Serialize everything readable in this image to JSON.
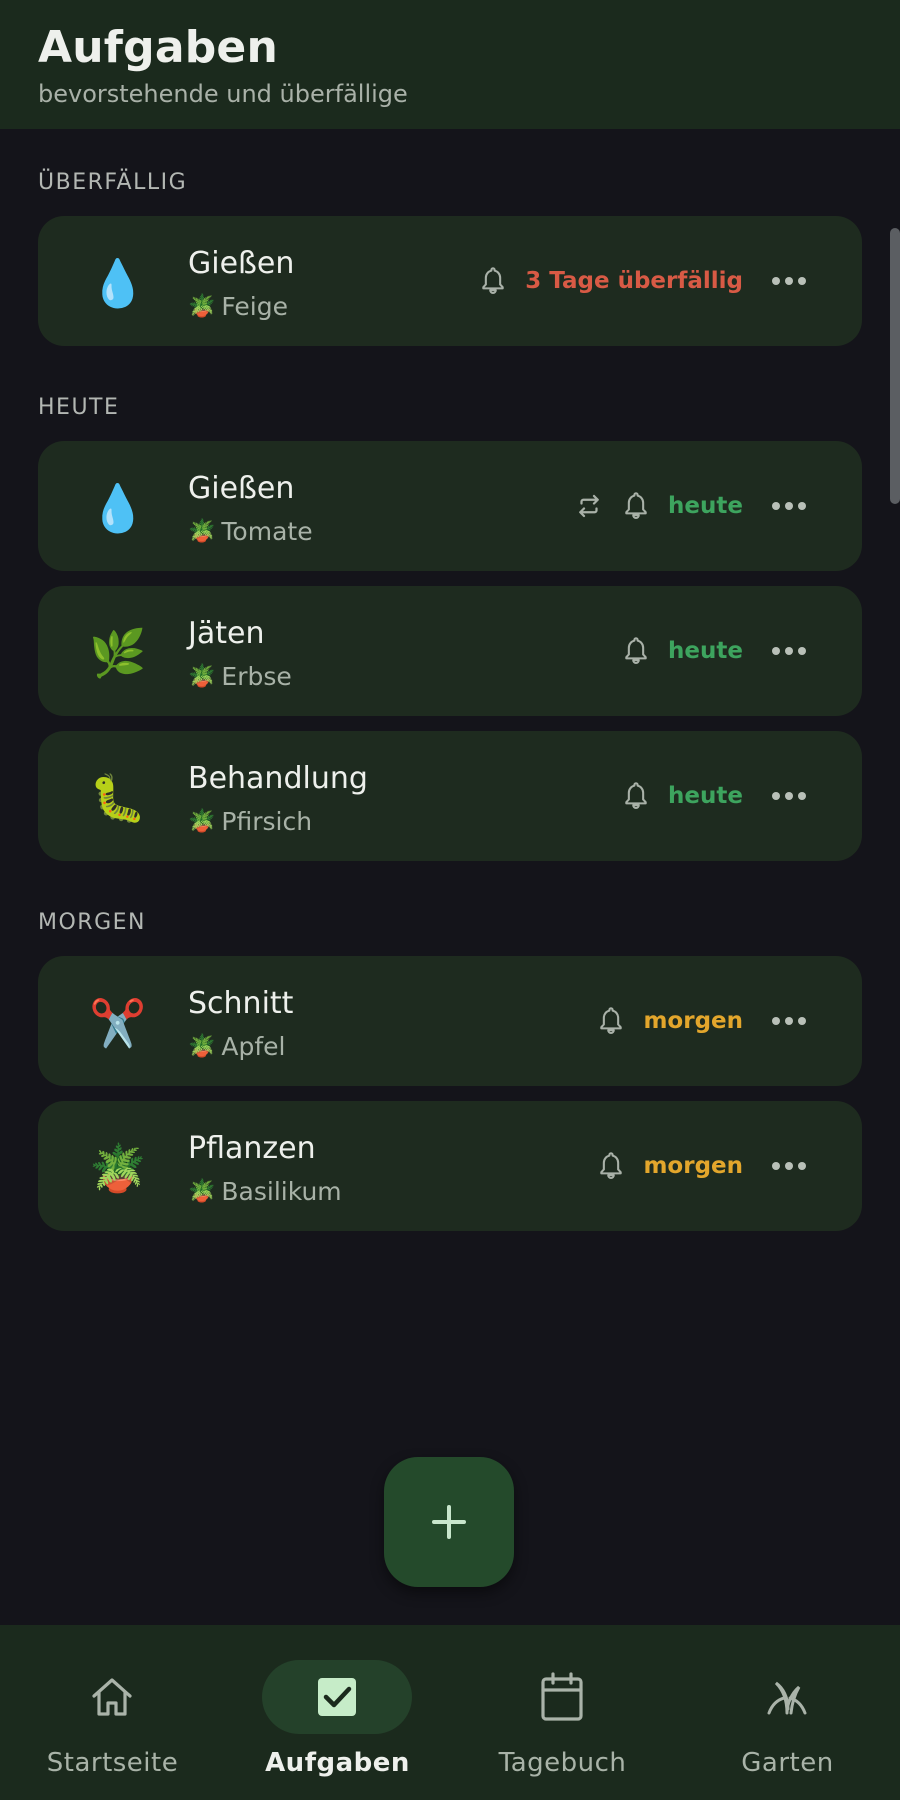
{
  "header": {
    "title": "Aufgaben",
    "subtitle": "bevorstehende und überfällige"
  },
  "sections": {
    "overdue": "ÜBERFÄLLIG",
    "today": "HEUTE",
    "tomorrow": "MORGEN"
  },
  "tasks": [
    {
      "icon": "droplet-icon",
      "emoji": "💧",
      "name": "Gießen",
      "plant": "Feige",
      "status": "3 Tage überfällig",
      "status_color": "#d85a45",
      "repeat": false
    },
    {
      "icon": "droplet-icon",
      "emoji": "💧",
      "name": "Gießen",
      "plant": "Tomate",
      "status": "heute",
      "status_color": "#3da45e",
      "repeat": true
    },
    {
      "icon": "herb-icon",
      "emoji": "🌿",
      "name": "Jäten",
      "plant": "Erbse",
      "status": "heute",
      "status_color": "#3da45e",
      "repeat": false
    },
    {
      "icon": "caterpillar-icon",
      "emoji": "🐛",
      "name": "Behandlung",
      "plant": "Pfirsich",
      "status": "heute",
      "status_color": "#3da45e",
      "repeat": false
    },
    {
      "icon": "scissors-icon",
      "emoji": "✂️",
      "name": "Schnitt",
      "plant": "Apfel",
      "status": "morgen",
      "status_color": "#e3a62c",
      "repeat": false
    },
    {
      "icon": "potted-plant-icon",
      "emoji": "🪴",
      "name": "Pflanzen",
      "plant": "Basilikum",
      "status": "morgen",
      "status_color": "#e3a62c",
      "repeat": false
    }
  ],
  "plant_icon": "🪴",
  "nav": [
    {
      "label": "Startseite",
      "icon": "home-icon",
      "active": false
    },
    {
      "label": "Aufgaben",
      "icon": "checkbox-icon",
      "active": true
    },
    {
      "label": "Tagebuch",
      "icon": "calendar-icon",
      "active": false
    },
    {
      "label": "Garten",
      "icon": "garden-icon",
      "active": false
    }
  ],
  "colors": {
    "background": "#14141a",
    "header": "#1b2a1d",
    "card": "#1e2b1f",
    "fab": "#244a2b",
    "overdue": "#d85a45",
    "today": "#3da45e",
    "tomorrow": "#e3a62c"
  }
}
